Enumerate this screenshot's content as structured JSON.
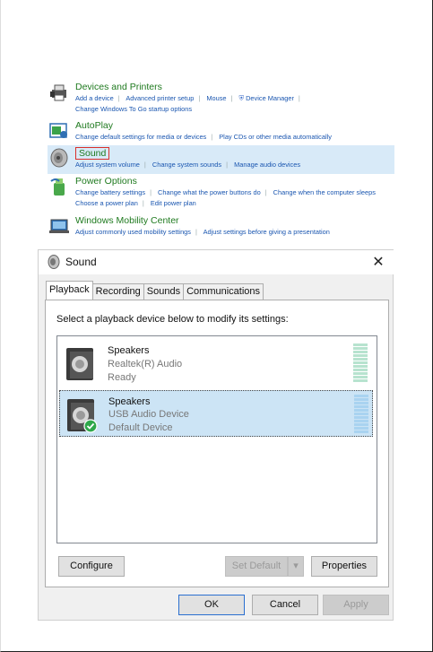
{
  "control_panel": {
    "items": [
      {
        "title": "Devices and Printers",
        "lines": [
          [
            "Add a device",
            "Advanced printer setup",
            "Mouse",
            "Device Manager"
          ],
          [
            "Change Windows To Go startup options"
          ]
        ]
      },
      {
        "title": "AutoPlay",
        "lines": [
          [
            "Change default settings for media or devices",
            "Play CDs or other media automatically"
          ]
        ]
      },
      {
        "title": "Sound",
        "lines": [
          [
            "Adjust system volume",
            "Change system sounds",
            "Manage audio devices"
          ]
        ]
      },
      {
        "title": "Power Options",
        "lines": [
          [
            "Change battery settings",
            "Change what the power buttons do",
            "Change when the computer sleeps"
          ],
          [
            "Choose a power plan",
            "Edit power plan"
          ]
        ]
      },
      {
        "title": "Windows Mobility Center",
        "lines": [
          [
            "Adjust commonly used mobility settings",
            "Adjust settings before giving a presentation"
          ]
        ]
      }
    ]
  },
  "dialog": {
    "title": "Sound",
    "close_glyph": "✕",
    "tabs": [
      "Playback",
      "Recording",
      "Sounds",
      "Communications"
    ],
    "active_tab": "Playback",
    "instruction": "Select a playback device below to modify its settings:",
    "devices": [
      {
        "name": "Speakers",
        "driver": "Realtek(R) Audio",
        "status": "Ready",
        "selected": false
      },
      {
        "name": "Speakers",
        "driver": "USB Audio Device",
        "status": "Default Device",
        "selected": true
      }
    ],
    "buttons": {
      "configure": "Configure",
      "set_default": "Set Default",
      "properties": "Properties",
      "ok": "OK",
      "cancel": "Cancel",
      "apply": "Apply"
    }
  },
  "colors": {
    "link": "#1a56b0",
    "title_green": "#1f7a1f",
    "highlight": "#d8eaf8",
    "selected_row": "#cce4f5",
    "check_green": "#2ea84a"
  }
}
